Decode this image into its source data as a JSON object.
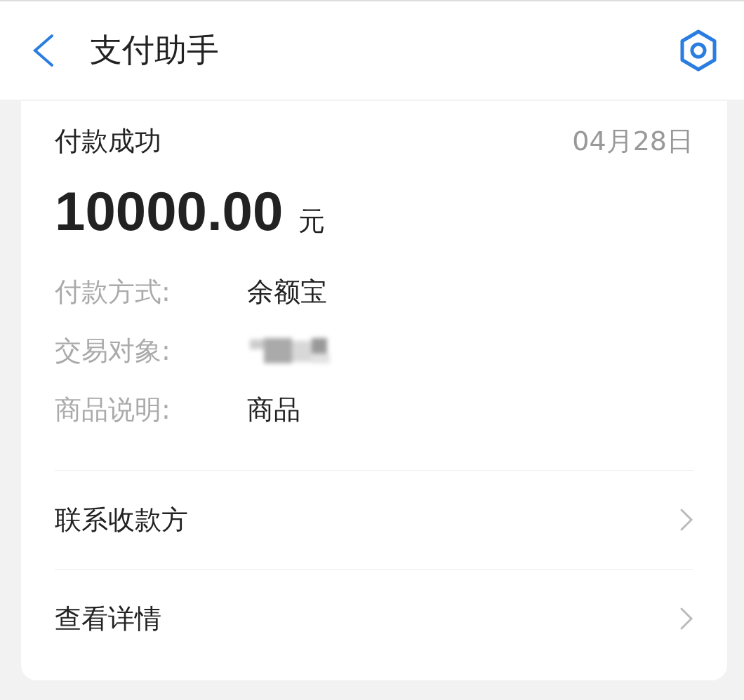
{
  "header": {
    "title": "支付助手"
  },
  "card": {
    "status": "付款成功",
    "date": "04月28日",
    "amount": "10000.00",
    "currency": "元",
    "details": [
      {
        "label": "付款方式:",
        "value": "余额宝",
        "redacted": false
      },
      {
        "label": "交易对象:",
        "redacted": true
      },
      {
        "label": "商品说明:",
        "value": "商品",
        "redacted": false
      }
    ],
    "links": [
      {
        "label": "联系收款方"
      },
      {
        "label": "查看详情"
      }
    ]
  }
}
